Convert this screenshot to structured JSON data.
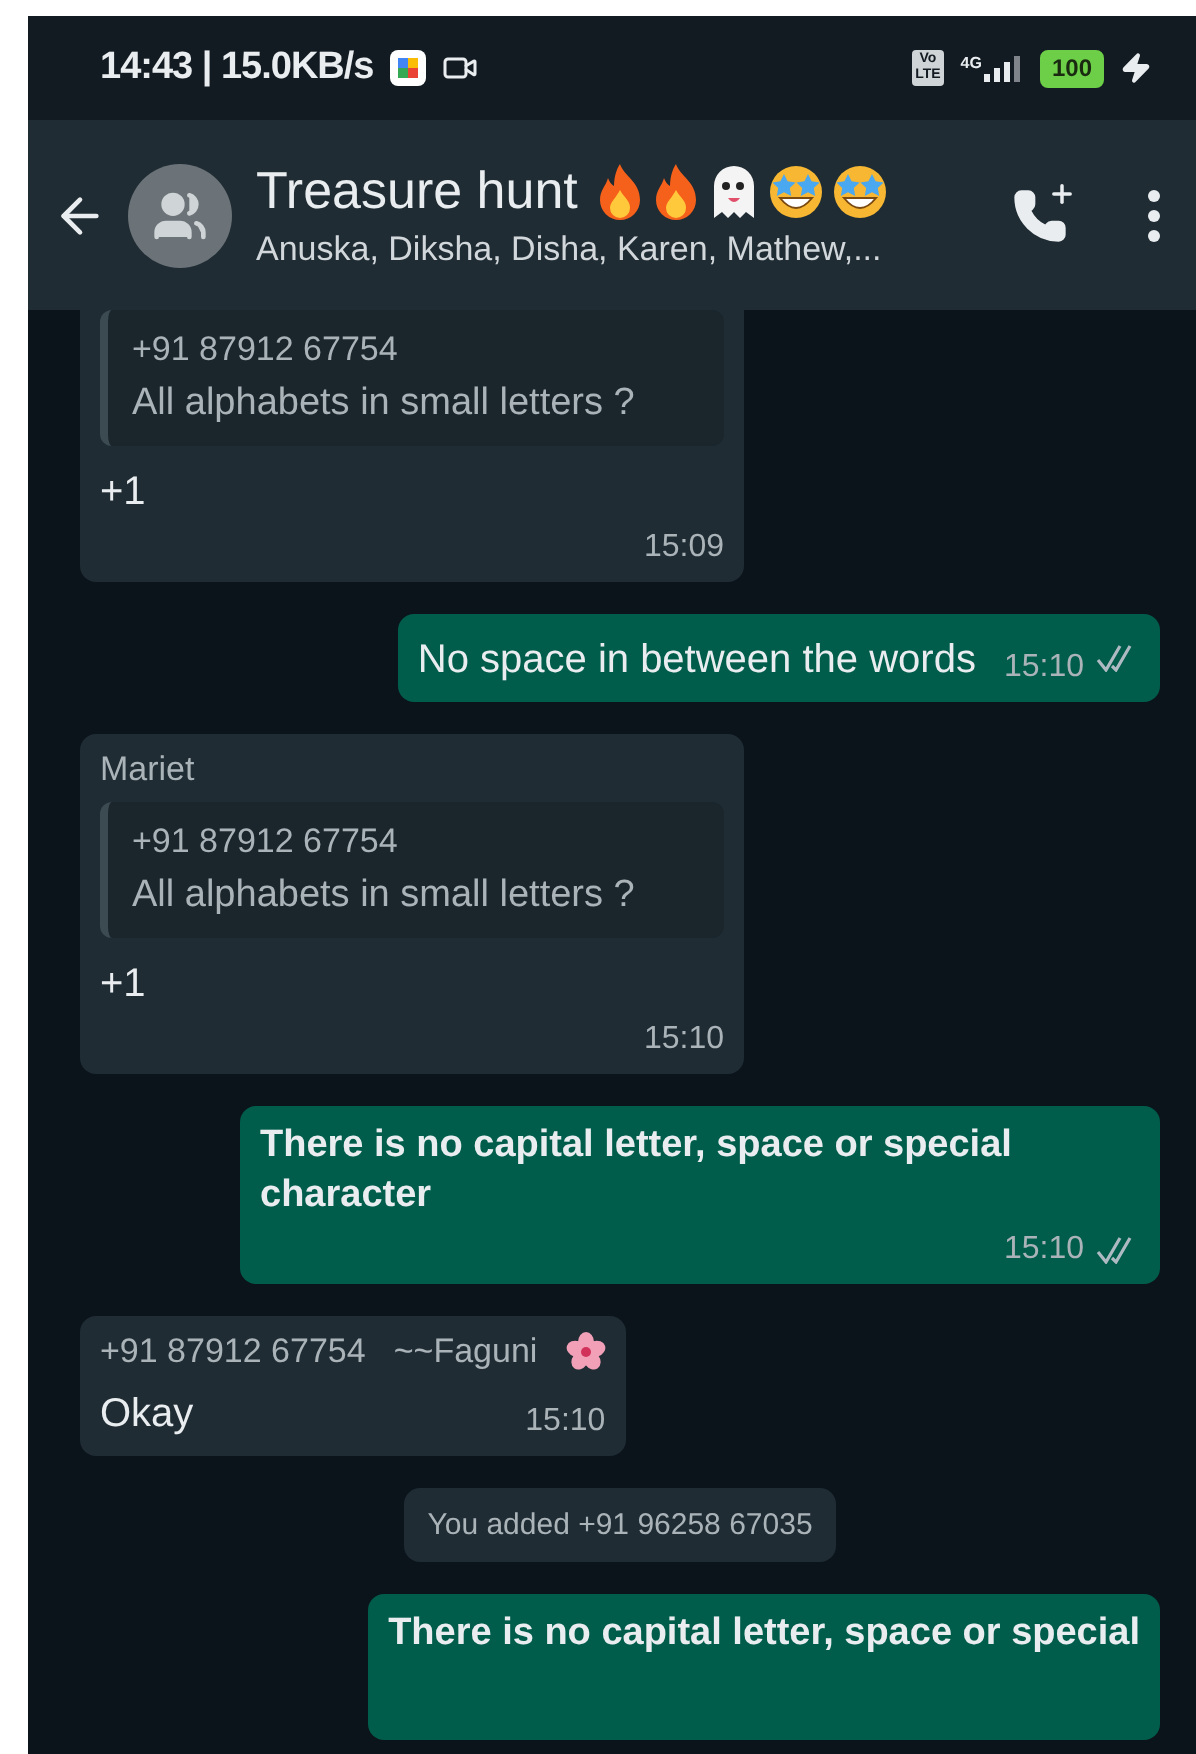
{
  "status_bar": {
    "time_speed": "14:43 | 15.0KB/s",
    "volte": [
      "Vo",
      "LTE"
    ],
    "network": "4G",
    "battery": "100",
    "charging": true
  },
  "header": {
    "title": "Treasure hunt",
    "members": "Anuska, Diksha, Disha, Karen, Mathew,..."
  },
  "messages": [
    {
      "kind": "incoming",
      "cut_top": true,
      "quote": {
        "sender": "+91 87912 67754",
        "text": "All alphabets in small letters  ?"
      },
      "text": "+1",
      "time": "15:09"
    },
    {
      "kind": "outgoing",
      "bold": false,
      "text": "No space in between the words",
      "time": "15:10",
      "read": true
    },
    {
      "kind": "incoming",
      "sender": "Mariet",
      "quote": {
        "sender": "+91 87912 67754",
        "text": "All alphabets in small letters  ?"
      },
      "text": "+1",
      "time": "15:10"
    },
    {
      "kind": "outgoing",
      "bold": true,
      "text": "There is no capital letter, space or special character",
      "time": "15:10",
      "read": true
    },
    {
      "kind": "incoming",
      "sender": "+91 87912 67754",
      "push_name": "~~Faguni",
      "text": "Okay",
      "time": "15:10"
    },
    {
      "kind": "system",
      "text": "You added +91 96258 67035"
    },
    {
      "kind": "outgoing",
      "bold": true,
      "cut_bottom": true,
      "text": "There is no capital letter, space or special"
    }
  ]
}
